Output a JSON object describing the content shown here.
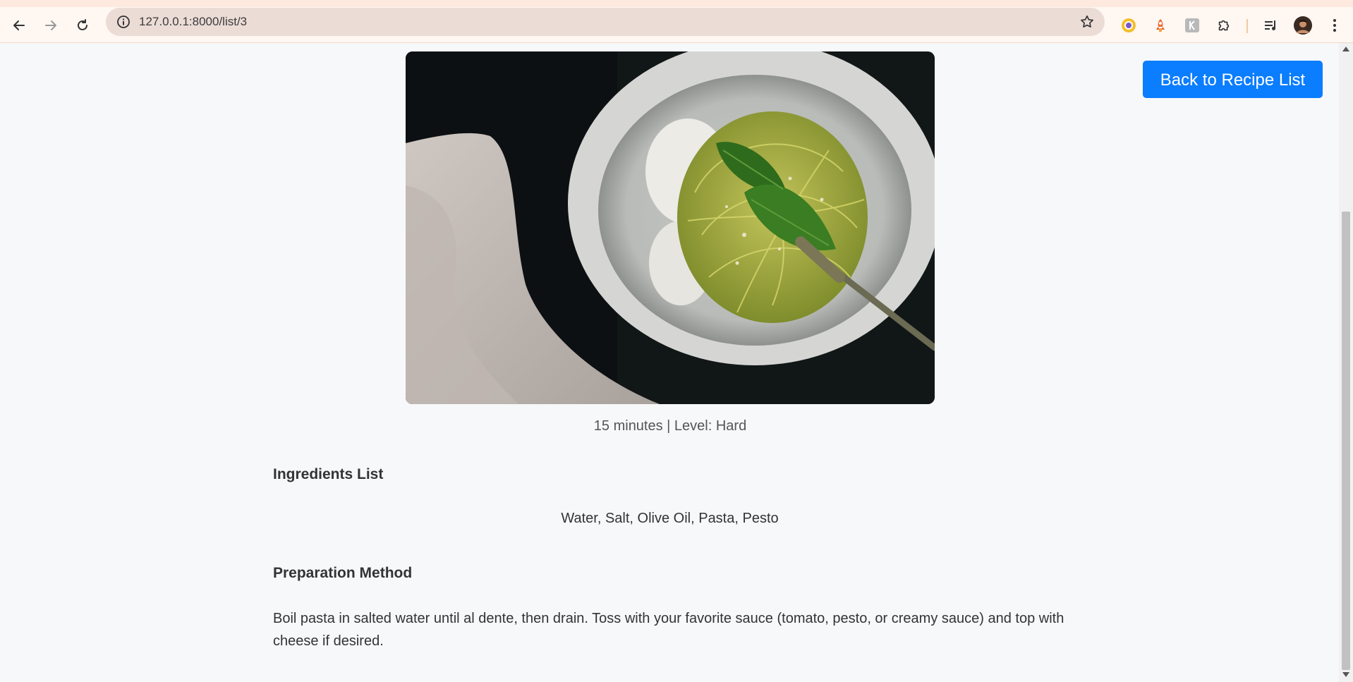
{
  "browser": {
    "url": "127.0.0.1:8000/list/3",
    "icons": [
      "back-arrow-icon",
      "forward-arrow-icon",
      "reload-icon",
      "site-info-icon",
      "bookmark-star-icon",
      "extension-chrome-icon",
      "extension-rocket-icon",
      "extension-k-icon",
      "extensions-puzzle-icon",
      "media-queue-icon",
      "profile-avatar",
      "more-menu-icon"
    ]
  },
  "page": {
    "back_button_label": "Back to Recipe List",
    "image_alt": "Pesto spaghetti in a white bowl topped with basil",
    "meta_line": "15 minutes | Level: Hard",
    "ingredients_title": "Ingredients List",
    "ingredients_text": "Water, Salt, Olive Oil, Pasta, Pesto",
    "method_title": "Preparation Method",
    "method_text": "Boil pasta in salted water until al dente, then drain. Toss with your favorite sauce (tomato, pesto, or creamy sauce) and top with cheese if desired."
  },
  "colors": {
    "accent": "#0b7dff",
    "page_background": "#f7f8fa",
    "toolbar_background": "#fef7f2"
  }
}
